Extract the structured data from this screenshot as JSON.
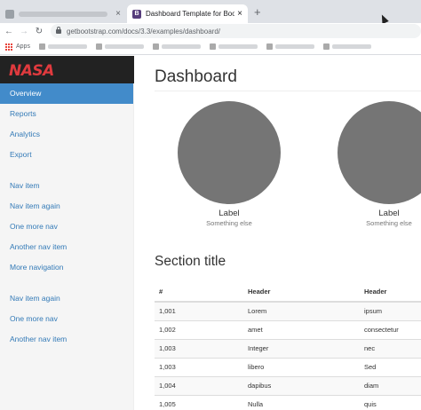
{
  "browser": {
    "tabs": [
      {
        "title": "",
        "active": false
      },
      {
        "title": "Dashboard Template for Bootstra",
        "active": true,
        "favicon": "B"
      }
    ],
    "new_tab": "+",
    "close_glyph": "×",
    "url": "getbootstrap.com/docs/3.3/examples/dashboard/",
    "bookmarks": {
      "apps_label": "Apps"
    }
  },
  "colors": {
    "sidebar_active": "#428bca",
    "link": "#337ab7",
    "topnav": "#222222",
    "logo": "#e03a3e",
    "placeholder_circle": "#757575"
  },
  "logo_text": "NASA",
  "sidebar": {
    "groups": [
      [
        "Overview",
        "Reports",
        "Analytics",
        "Export"
      ],
      [
        "Nav item",
        "Nav item again",
        "One more nav",
        "Another nav item",
        "More navigation"
      ],
      [
        "Nav item again",
        "One more nav",
        "Another nav item"
      ]
    ],
    "active": "Overview"
  },
  "main": {
    "title": "Dashboard",
    "placeholders": [
      {
        "label": "Label",
        "sub": "Something else"
      },
      {
        "label": "Label",
        "sub": "Something else"
      }
    ],
    "section_title": "Section title",
    "table": {
      "headers": [
        "#",
        "Header",
        "Header"
      ],
      "rows": [
        [
          "1,001",
          "Lorem",
          "ipsum"
        ],
        [
          "1,002",
          "amet",
          "consectetur"
        ],
        [
          "1,003",
          "Integer",
          "nec"
        ],
        [
          "1,003",
          "libero",
          "Sed"
        ],
        [
          "1,004",
          "dapibus",
          "diam"
        ],
        [
          "1,005",
          "Nulla",
          "quis"
        ]
      ]
    }
  }
}
